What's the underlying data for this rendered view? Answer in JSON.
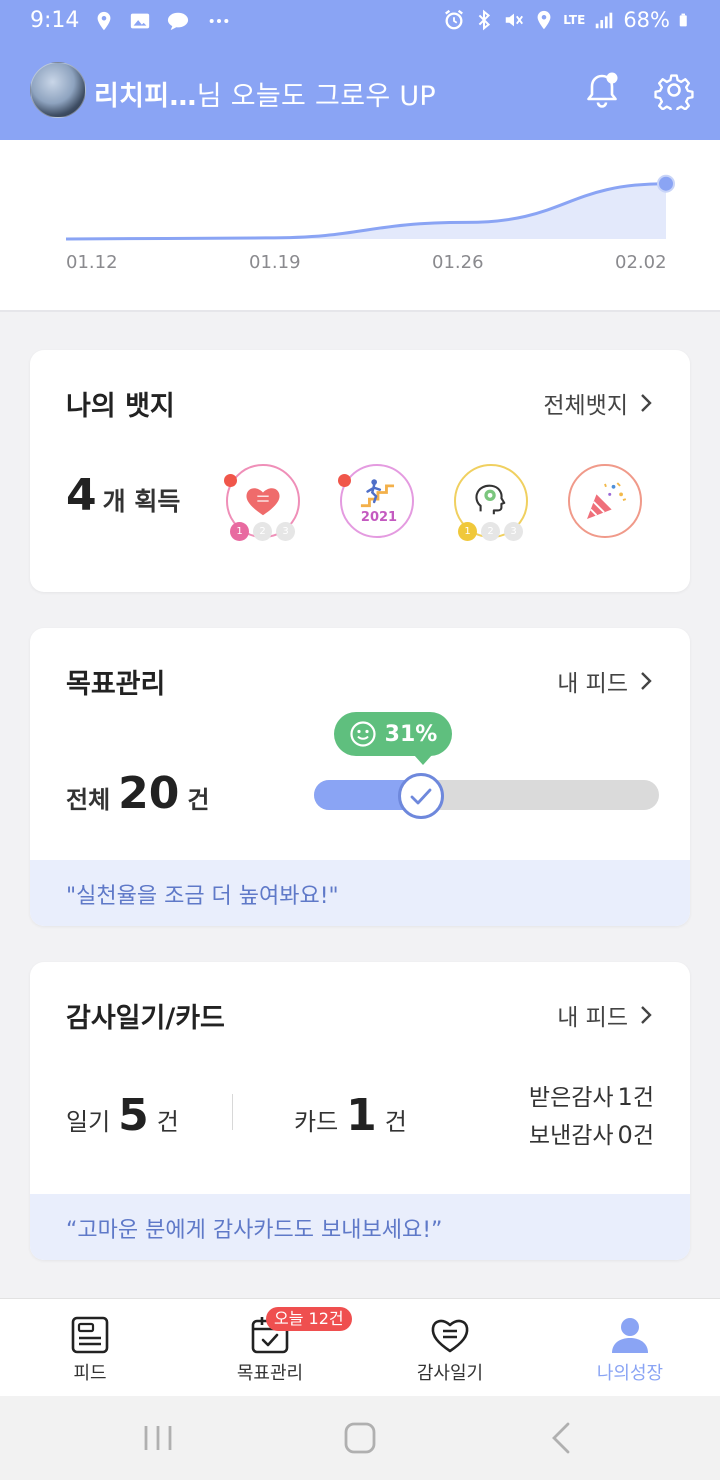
{
  "status_bar": {
    "time": "9:14",
    "left_icons": [
      "location-icon",
      "gallery-icon",
      "talk-icon",
      "more-dots-icon"
    ],
    "right_icons": [
      "alarm-icon",
      "bluetooth-icon",
      "mute-icon",
      "location-icon",
      "lte-icon",
      "signal-icon",
      "battery-icon"
    ],
    "network": "LTE",
    "battery": "68%"
  },
  "header": {
    "user_name": "리치피…",
    "greeting_suffix": "님 오늘도 그로우 UP",
    "notification_dot": true
  },
  "growth_chart": {
    "chart_data": {
      "type": "area",
      "categories": [
        "01.12",
        "01.19",
        "01.26",
        "02.02"
      ],
      "values": [
        0,
        0.3,
        4.5,
        15
      ],
      "ylim": [
        0,
        16
      ],
      "highlight_last_point": true,
      "color": "#8aa4f4"
    }
  },
  "badges": {
    "title": "나의 뱃지",
    "link_label": "전체뱃지",
    "count": "4",
    "count_unit": "개 획득",
    "items": [
      {
        "name": "heart-badge",
        "ring_color": "#ef8fb8",
        "new": true,
        "levels": [
          "1",
          "2",
          "3"
        ],
        "level": 1
      },
      {
        "name": "stairs-badge",
        "ring_color": "#e49be0",
        "new": true,
        "year": "2021"
      },
      {
        "name": "mind-gear-badge",
        "ring_color": "#f0d060",
        "new": false,
        "levels": [
          "1",
          "2",
          "3"
        ],
        "level": 1
      },
      {
        "name": "party-popper-badge",
        "ring_color": "#f09a8a",
        "new": false
      }
    ]
  },
  "goals": {
    "title": "목표관리",
    "link_label": "내 피드",
    "total_label": "전체",
    "total": "20",
    "total_unit": "건",
    "progress_text": "31%",
    "progress": 0.31,
    "message": "\"실천율을 조금 더 높여봐요!\""
  },
  "gratitude": {
    "title": "감사일기/카드",
    "link_label": "내 피드",
    "diary_label": "일기",
    "diary_count": "5",
    "card_label": "카드",
    "card_count": "1",
    "unit": "건",
    "received_label": "받은감사",
    "received_count": "1",
    "sent_label": "보낸감사",
    "sent_count": "0",
    "message": "“고마운 분에게 감사카드도 보내보세요!”"
  },
  "bottom_nav": {
    "items": [
      {
        "label": "피드",
        "icon": "feed-icon",
        "active": false
      },
      {
        "label": "목표관리",
        "icon": "calendar-check-icon",
        "active": false,
        "badge": "오늘 12건"
      },
      {
        "label": "감사일기",
        "icon": "heart-note-icon",
        "active": false
      },
      {
        "label": "나의성장",
        "icon": "person-icon",
        "active": true
      }
    ]
  }
}
